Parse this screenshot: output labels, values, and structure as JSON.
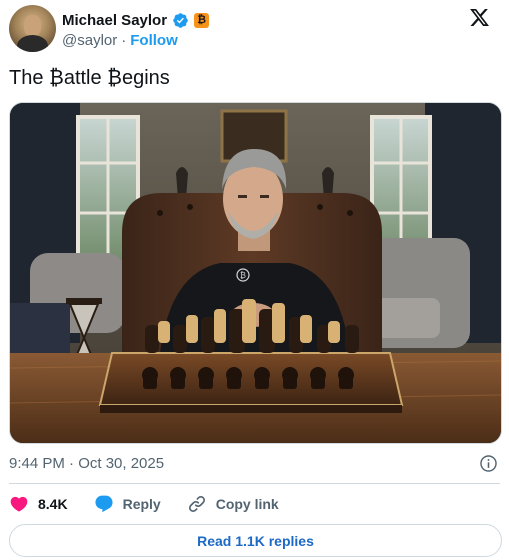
{
  "author": {
    "name": "Michael Saylor",
    "handle": "@saylor",
    "separator": "·",
    "follow_label": "Follow",
    "badge_glyph": "₿"
  },
  "tweet": {
    "text": "The ₿attle ₿egins"
  },
  "media": {
    "badge_glyph": "₿"
  },
  "meta": {
    "timestamp": "9:44 PM · Oct 30, 2025"
  },
  "actions": {
    "likes": "8.4K",
    "reply_label": "Reply",
    "copy_link_label": "Copy link"
  },
  "footer": {
    "read_replies_label": "Read 1.1K replies"
  },
  "colors": {
    "accent_blue": "#1d9bf0",
    "like_pink": "#f91880",
    "text_primary": "#0f1419",
    "text_secondary": "#536471",
    "bitcoin_orange": "#f7931a"
  },
  "icons": {
    "verified": "verified-badge-icon",
    "x_logo": "x-logo-icon",
    "info": "info-icon",
    "like": "heart-icon",
    "reply": "speech-bubble-icon",
    "copy": "link-icon"
  }
}
